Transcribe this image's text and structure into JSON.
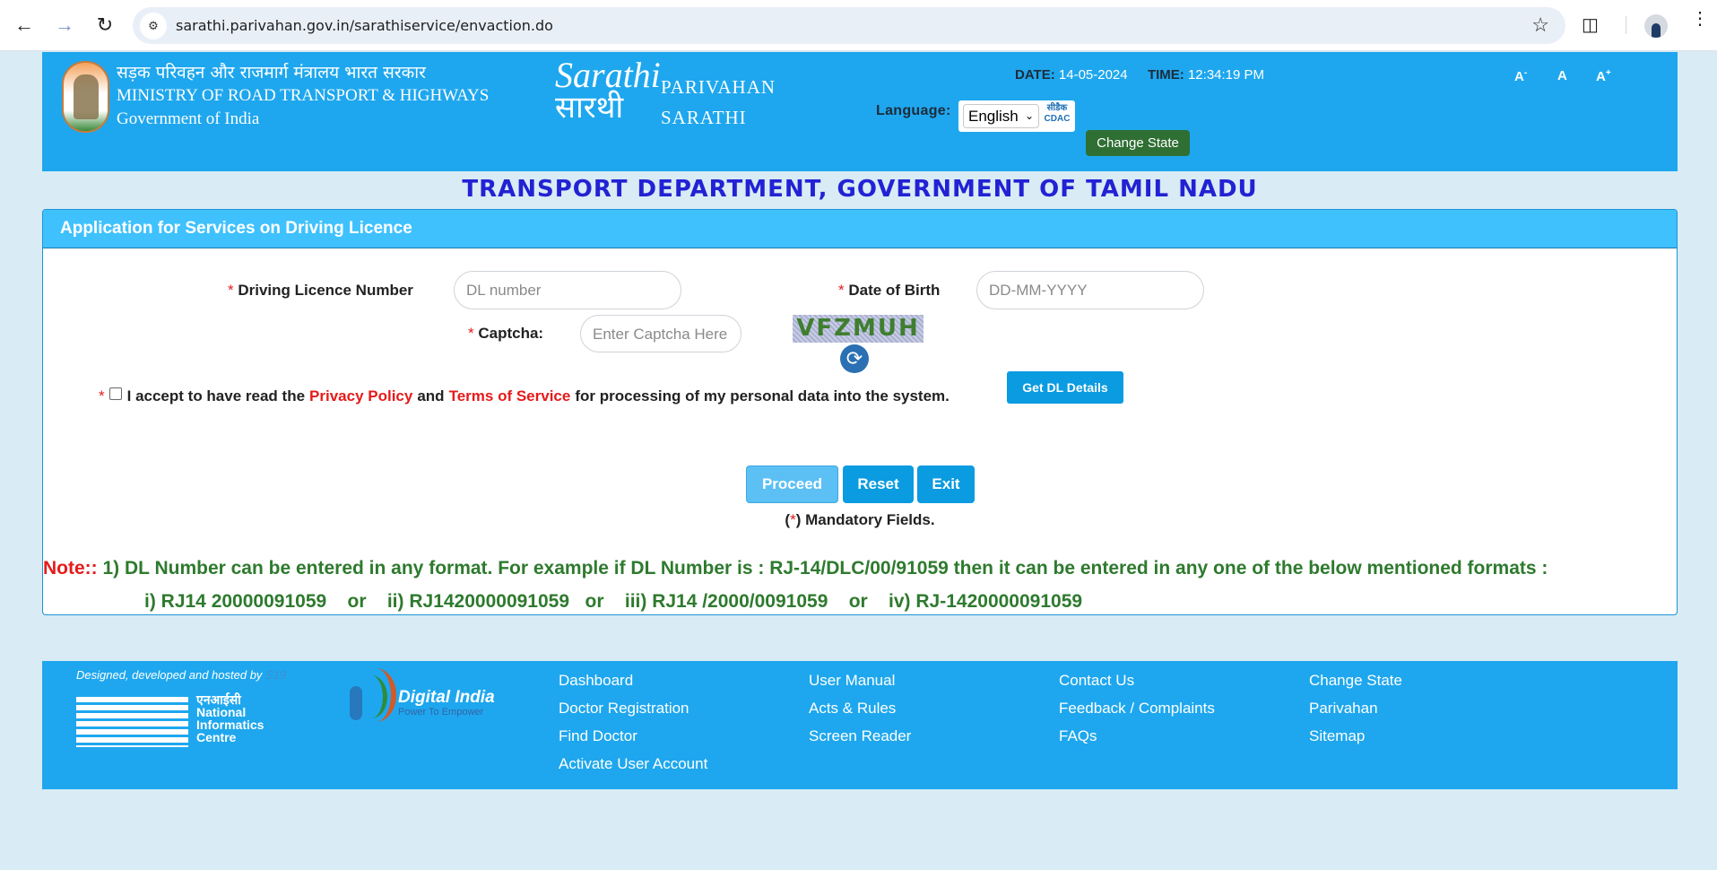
{
  "browser": {
    "url": "sarathi.parivahan.gov.in/sarathiservice/envaction.do",
    "icons": [
      "back-arrow-icon",
      "forward-arrow-icon",
      "reload-icon",
      "site-settings-icon",
      "bookmark-star-icon",
      "extensions-icon",
      "profile-avatar-icon",
      "menu-kebab-icon"
    ]
  },
  "header": {
    "ministry_hindi": "सड़क परिवहन और राजमार्ग मंत्रालय भारत सरकार",
    "ministry_english": "MINISTRY OF ROAD TRANSPORT & HIGHWAYS",
    "government": "Government of India",
    "logo_sarathi_en": "Sarathi",
    "logo_sarathi_hi": "सारथी",
    "brand_line1": "PARIVAHAN",
    "brand_line2": "SARATHI",
    "date_label": "DATE:",
    "date_value": "14-05-2024",
    "time_label": "TIME:",
    "time_value": "12:34:19 PM",
    "language_label": "Language:",
    "language_selected": "English",
    "cdac_hi": "सीडैक",
    "cdac_en": "CDAC",
    "change_state": "Change State",
    "font_decrease": "A",
    "font_decrease_sup": "-",
    "font_normal": "A",
    "font_increase": "A",
    "font_increase_sup": "+"
  },
  "dept_title": "TRANSPORT DEPARTMENT, GOVERNMENT OF TAMIL NADU",
  "form": {
    "panel_title": "Application for Services on Driving Licence",
    "required_mark": "*",
    "dl_label": "Driving Licence Number",
    "dl_placeholder": "DL number",
    "dob_label": "Date of Birth",
    "dob_placeholder": "DD-MM-YYYY",
    "captcha_label": "Captcha:",
    "captcha_placeholder": "Enter Captcha Here",
    "captcha_text": "VFZMUH",
    "consent_pre": "I accept to have read the",
    "privacy_policy": "Privacy Policy",
    "consent_and": "and",
    "terms_of_service": "Terms of Service",
    "consent_post": "for processing of my personal data into the system.",
    "get_dl_details": "Get DL Details",
    "proceed": "Proceed",
    "reset": "Reset",
    "exit": "Exit",
    "mandatory_open": "(",
    "mandatory_close": ") Mandatory Fields.",
    "note_label": "Note::",
    "note_line1": " 1) DL Number can be entered in any format. For example if DL Number is : RJ-14/DLC/00/91059 then it can be entered in any one of the below mentioned formats :",
    "note_line2": "i) RJ14 20000091059    or    ii) RJ1420000091059   or    iii) RJ14 /2000/0091059    or    iv) RJ-1420000091059"
  },
  "footer": {
    "designed_by": "Designed, developed and hosted by",
    "designed_by_org": "S19",
    "nic_hindi": "एनआईसी",
    "nic_line1": "National",
    "nic_line2": "Informatics",
    "nic_line3": "Centre",
    "digital_india": "Digital India",
    "digital_india_tagline": "Power To Empower",
    "links_col1": [
      "Dashboard",
      "Doctor Registration",
      "Find Doctor",
      "Activate User Account"
    ],
    "links_col2": [
      "User Manual",
      "Acts & Rules",
      "Screen Reader"
    ],
    "links_col3": [
      "Contact Us",
      "Feedback / Complaints",
      "FAQs"
    ],
    "links_col4": [
      "Change State",
      "Parivahan",
      "Sitemap"
    ]
  },
  "colors": {
    "header_bg": "#1ea7ee",
    "panel_head": "#3fc1fd",
    "title_blue": "#2222d4",
    "note_green": "#2e7a2e",
    "required_red": "#e21b1b",
    "change_state_green": "#2f6f34",
    "button_blue": "#0a9be0"
  }
}
